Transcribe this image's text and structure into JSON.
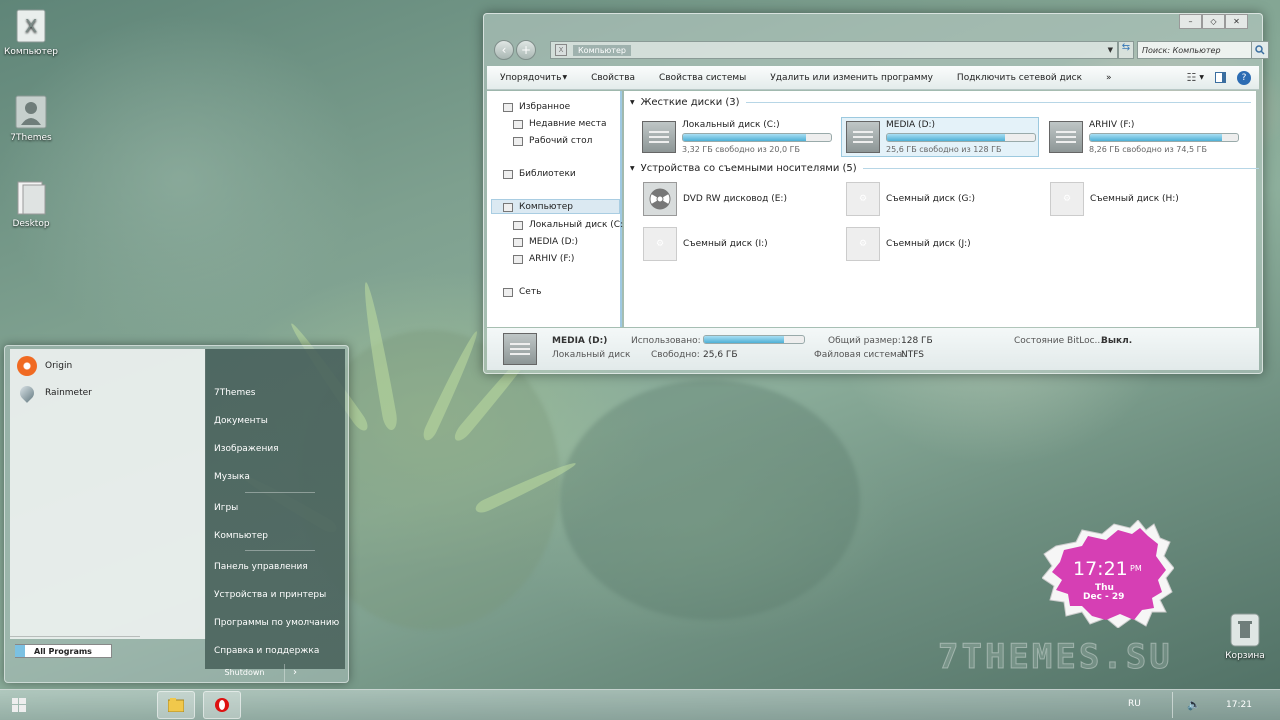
{
  "desktop": {
    "icons": [
      {
        "label": "Компьютер"
      },
      {
        "label": "7Themes"
      },
      {
        "label": "Desktop"
      },
      {
        "label": "Корзина"
      }
    ],
    "watermark": "7THEMES.SU"
  },
  "explorer": {
    "address": "Компьютер",
    "search_placeholder": "Поиск: Компьютер",
    "toolbar": [
      "Упорядочить",
      "Свойства",
      "Свойства системы",
      "Удалить или изменить программу",
      "Подключить сетевой диск",
      "»"
    ],
    "nav": {
      "favorites": "Избранное",
      "recent": "Недавние места",
      "desktop": "Рабочий стол",
      "libraries": "Библиотеки",
      "computer": "Компьютер",
      "drive_c": "Локальный диск (C:)",
      "drive_d": "MEDIA (D:)",
      "drive_f": "ARHIV (F:)",
      "network": "Сеть"
    },
    "hdd_group": "Жесткие диски (3)",
    "drives": [
      {
        "name": "Локальный диск (C:)",
        "free": "3,32 ГБ свободно из 20,0 ГБ",
        "used": 0.834
      },
      {
        "name": "MEDIA (D:)",
        "free": "25,6 ГБ свободно из 128 ГБ",
        "used": 0.8
      },
      {
        "name": "ARHIV (F:)",
        "free": "8,26 ГБ свободно из 74,5 ГБ",
        "used": 0.889
      }
    ],
    "removable_group": "Устройства со съемными носителями (5)",
    "removable": [
      "DVD RW дисковод (E:)",
      "Съемный диск (G:)",
      "Съемный диск (H:)",
      "Съемный диск (I:)",
      "Съемный диск (J:)"
    ],
    "details": {
      "name": "MEDIA (D:)",
      "type": "Локальный диск",
      "used_label": "Использовано:",
      "used": 0.8,
      "free_label": "Свободно:",
      "free_value": "25,6 ГБ",
      "total_label": "Общий размер:",
      "total_value": "128 ГБ",
      "fs_label": "Файловая система:",
      "fs_value": "NTFS",
      "bitlocker_label": "Состояние BitLoc...",
      "bitlocker_value": "Выкл."
    }
  },
  "startmenu": {
    "programs": [
      "Origin",
      "Rainmeter"
    ],
    "all_programs": "All Programs",
    "right": [
      "7Themes",
      "Документы",
      "Изображения",
      "Музыка",
      "Игры",
      "Компьютер",
      "Панель управления",
      "Устройства и принтеры",
      "Программы по умолчанию",
      "Справка и поддержка"
    ],
    "shutdown": "Shutdown",
    "shutdown_arrow": "›"
  },
  "clock_gadget": {
    "time": "17:21",
    "ampm": "PM",
    "day": "Thu",
    "date": "Dec - 29",
    "color": "#d63fb4"
  },
  "taskbar": {
    "lang": "RU",
    "time": "17:21"
  }
}
